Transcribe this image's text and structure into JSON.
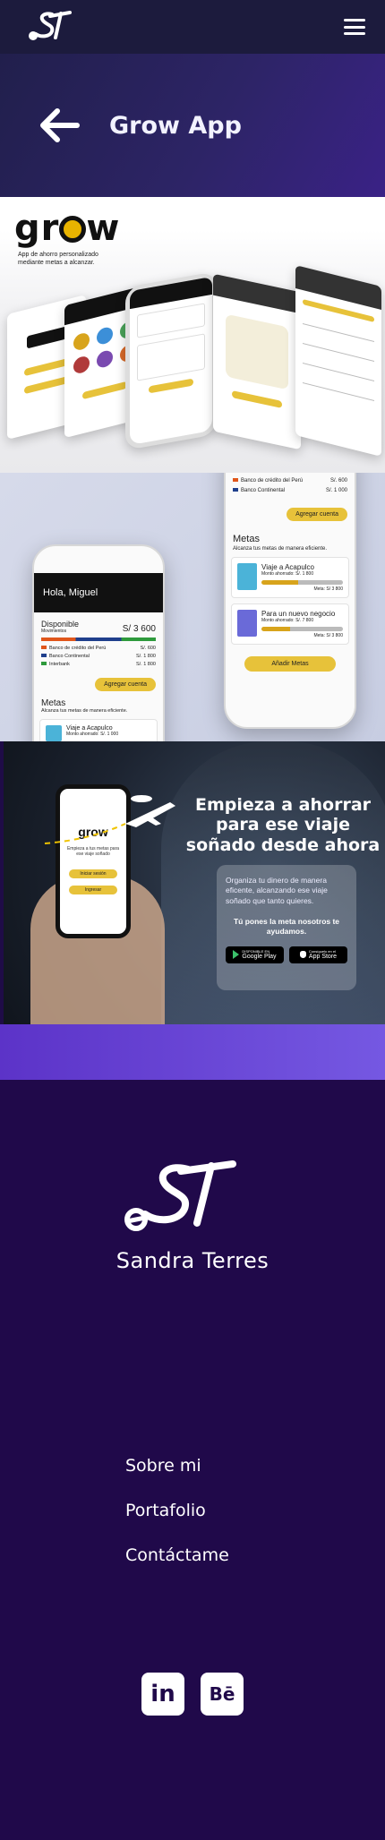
{
  "nav": {
    "logo_icon": "st-logo-icon",
    "menu_icon": "hamburger-menu-icon"
  },
  "hero": {
    "back_icon": "arrow-left-icon",
    "title": "Grow App"
  },
  "showcase1": {
    "app_logo": "grow",
    "tagline": "App de ahorro personalizado mediante metas a alcanzar."
  },
  "showcase2": {
    "phone_left": {
      "greeting": "Hola, Miguel",
      "available_label": "Disponible",
      "available_sub": "Movimientos",
      "available_amount": "S/ 3 600",
      "accounts": [
        {
          "name": "Banco de crédito del Perú",
          "amount": "S/. 600",
          "color": "#e0561b"
        },
        {
          "name": "Banco Continental",
          "amount": "S/. 1 800",
          "color": "#1f3f8c"
        },
        {
          "name": "Interbank",
          "amount": "S/. 1 800",
          "color": "#2e9a3c"
        }
      ],
      "add_account": "Agregar cuenta",
      "goals_title": "Metas",
      "goals_sub": "Alcanza tus metas de manera eficiente.",
      "goal_item": "Viaje a Acapulco",
      "goal_item_sub": "Monto ahorrado: S/. 1 000"
    },
    "phone_right": {
      "accounts": [
        {
          "name": "Banco de crédito del Perú",
          "amount": "S/. 600",
          "color": "#e0561b"
        },
        {
          "name": "Banco Continental",
          "amount": "S/. 1 000",
          "color": "#1f3f8c"
        }
      ],
      "add_account": "Agregar cuenta",
      "goals_title": "Metas",
      "goals_sub": "Alcanza tus metas de manera eficiente.",
      "goals": [
        {
          "title": "Viaje a Acapulco",
          "saved": "Monto ahorrado: S/. 1 800",
          "target": "Meta: S/ 3 800",
          "progress": 0.45
        },
        {
          "title": "Para un nuevo negocio",
          "saved": "Monto ahorrado: S/. 7 800",
          "target": "Meta: S/ 3 800",
          "progress": 0.35
        }
      ],
      "add_goals": "Añadir Metas"
    }
  },
  "promo": {
    "headline": "Empieza a ahorrar para ese viaje soñado desde ahora",
    "phone_logo": "grow",
    "phone_text": "Empieza a tus metas para ese viaje soñado",
    "phone_btn1": "Iniciar sesión",
    "phone_btn2": "Ingresar",
    "body": "Organiza tu dinero de manera eficente, alcanzando ese viaje soñado  que tanto quieres.",
    "strong": "Tú pones la meta nosotros te ayudamos.",
    "store_google_small": "DISPONIBLE EN",
    "store_google": "Google Play",
    "store_apple_small": "Consíguelo en el",
    "store_apple": "App Store"
  },
  "footer": {
    "logo_icon": "st-logo-icon",
    "name": "Sandra Terres",
    "links": [
      "Sobre mi",
      "Portafolio",
      "Contáctame"
    ],
    "linkedin_text": "in",
    "behance_text": "Bē"
  },
  "colors": {
    "nav_bg": "#1c1b3d",
    "footer_bg": "#20094a",
    "band_purple": "#6a47d6",
    "grow_yellow": "#e8b300"
  }
}
